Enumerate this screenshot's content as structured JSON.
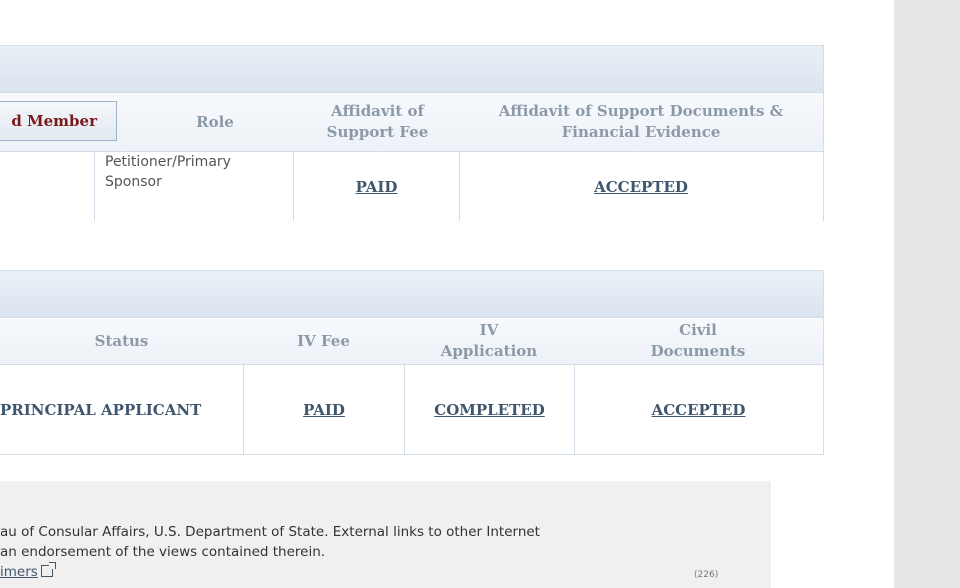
{
  "sponsor_table": {
    "headers": {
      "member": "d Member",
      "role": "Role",
      "aos_fee_line1": "Affidavit of",
      "aos_fee_line2": "Support Fee",
      "aos_docs_line1": "Affidavit of Support Documents &",
      "aos_docs_line2": "Financial Evidence"
    },
    "row": {
      "role_line1": "Petitioner/Primary",
      "role_line2": "Sponsor",
      "aos_fee": "PAID",
      "aos_docs": "ACCEPTED"
    }
  },
  "applicant_table": {
    "headers": {
      "status": "Status",
      "iv_fee": "IV Fee",
      "iv_app_line1": "IV",
      "iv_app_line2": "Application",
      "civil_line1": "Civil",
      "civil_line2": "Documents"
    },
    "row": {
      "status": "PRINCIPAL APPLICANT",
      "iv_fee": "PAID",
      "iv_app": "COMPLETED",
      "civil": "ACCEPTED"
    }
  },
  "footer": {
    "line1": "au of Consular Affairs, U.S. Department of State. External links to other Internet",
    "line2": "an endorsement of the views contained therein.",
    "disclaimers_link": "imers",
    "page_code": "(226)"
  }
}
